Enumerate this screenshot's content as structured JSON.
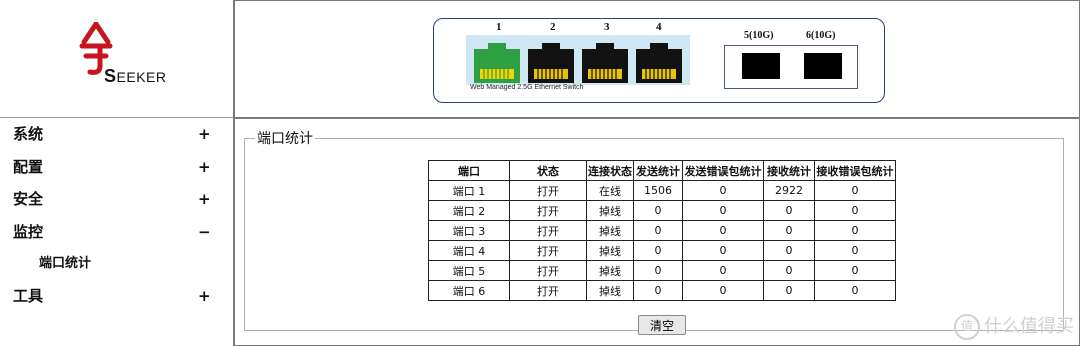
{
  "logo": {
    "brand": "SEEKER",
    "brand_first": "S",
    "brand_rest": "EEKER",
    "symbol": "chinese-seal-glyph"
  },
  "sidebar": {
    "items": [
      {
        "label": "系统",
        "sign": "+"
      },
      {
        "label": "配置",
        "sign": "+"
      },
      {
        "label": "安全",
        "sign": "+"
      },
      {
        "label": "监控",
        "sign": "−",
        "sub": [
          {
            "label": "端口统计"
          }
        ]
      },
      {
        "label": "工具",
        "sign": "+"
      }
    ]
  },
  "switch_panel": {
    "port_numbers": [
      "1",
      "2",
      "3",
      "4"
    ],
    "caption": "Web Managed 2.5G Ethernet Switch",
    "sfp_labels": [
      "5(10G)",
      "6(10G)"
    ],
    "colors": {
      "active_port": "#2ea043",
      "inactive_port": "#111111",
      "led": "#e8c400",
      "panel_border": "#2d3f7a"
    }
  },
  "stats": {
    "legend": "端口统计",
    "headers": [
      "端口",
      "状态",
      "连接状态",
      "发送统计",
      "发送错误包统计",
      "接收统计",
      "接收错误包统计"
    ],
    "rows": [
      [
        "端口 1",
        "打开",
        "在线",
        "1506",
        "0",
        "2922",
        "0"
      ],
      [
        "端口 2",
        "打开",
        "掉线",
        "0",
        "0",
        "0",
        "0"
      ],
      [
        "端口 3",
        "打开",
        "掉线",
        "0",
        "0",
        "0",
        "0"
      ],
      [
        "端口 4",
        "打开",
        "掉线",
        "0",
        "0",
        "0",
        "0"
      ],
      [
        "端口 5",
        "打开",
        "掉线",
        "0",
        "0",
        "0",
        "0"
      ],
      [
        "端口 6",
        "打开",
        "掉线",
        "0",
        "0",
        "0",
        "0"
      ]
    ],
    "clear_label": "清空"
  },
  "watermark": {
    "text": "什么值得买",
    "icon": "值"
  }
}
